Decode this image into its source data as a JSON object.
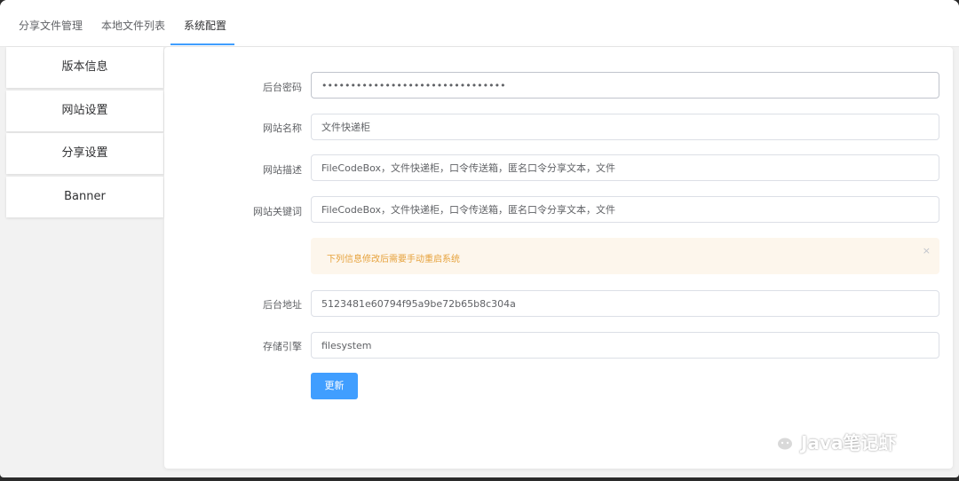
{
  "tabs": [
    {
      "label": "分享文件管理"
    },
    {
      "label": "本地文件列表"
    },
    {
      "label": "系统配置",
      "active": true
    }
  ],
  "sidebar": {
    "items": [
      {
        "label": "版本信息"
      },
      {
        "label": "网站设置"
      },
      {
        "label": "分享设置"
      },
      {
        "label": "Banner"
      }
    ]
  },
  "form": {
    "admin_password": {
      "label": "后台密码",
      "value": "••••••••••••••••••••••••••••••••"
    },
    "site_name": {
      "label": "网站名称",
      "value": "文件快递柜"
    },
    "site_description": {
      "label": "网站描述",
      "value": "FileCodeBox，文件快递柜，口令传送箱，匿名口令分享文本，文件"
    },
    "site_keywords": {
      "label": "网站关键词",
      "value": "FileCodeBox，文件快递柜，口令传送箱，匿名口令分享文本，文件"
    },
    "alert": {
      "text": "下列信息修改后需要手动重启系统",
      "close": "×"
    },
    "admin_address": {
      "label": "后台地址",
      "value": "5123481e60794f95a9be72b65b8c304a"
    },
    "storage_engine": {
      "label": "存储引擎",
      "value": "filesystem"
    },
    "submit_label": "更新"
  },
  "watermark": {
    "text": "Java笔记虾",
    "icon": "wechat-icon"
  },
  "colors": {
    "accent": "#409eff",
    "warning": "#e6a23c",
    "warning_bg": "#fdf6ec"
  }
}
